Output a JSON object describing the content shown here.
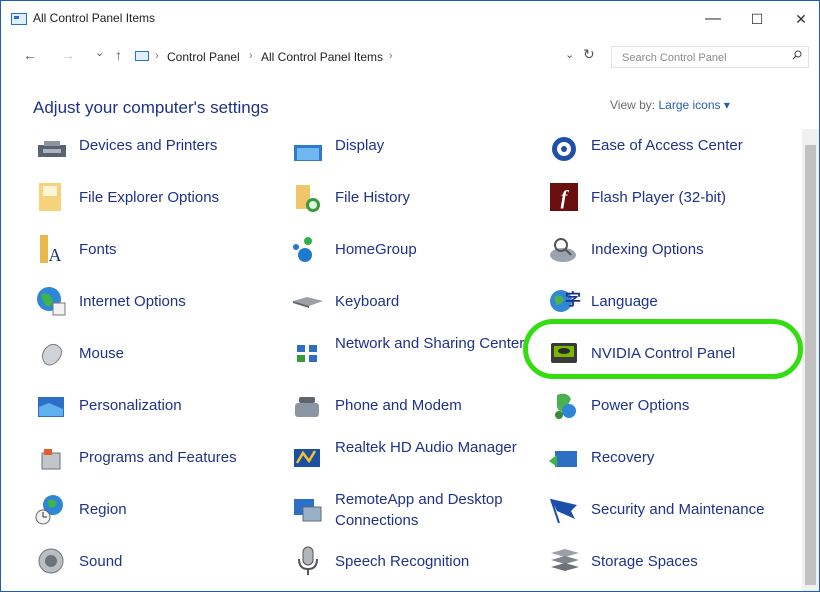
{
  "window": {
    "title": "All Control Panel Items",
    "minimize": "—",
    "maximize": "☐",
    "close": "✕"
  },
  "address": {
    "back": "←",
    "forward": "→",
    "recent": "⌄",
    "up": "↑",
    "crumbs": [
      "Control Panel",
      "All Control Panel Items"
    ],
    "separator": "›",
    "dropdown": "⌄",
    "refresh": "↻"
  },
  "search": {
    "placeholder": "Search Control Panel"
  },
  "page": {
    "heading": "Adjust your computer's settings"
  },
  "view": {
    "label": "View by:",
    "mode": "Large icons ▾"
  },
  "items": [
    [
      "Devices and Printers",
      "Display",
      "Ease of Access Center"
    ],
    [
      "File Explorer Options",
      "File History",
      "Flash Player (32-bit)"
    ],
    [
      "Fonts",
      "HomeGroup",
      "Indexing Options"
    ],
    [
      "Internet Options",
      "Keyboard",
      "Language"
    ],
    [
      "Mouse",
      "Network and Sharing Center",
      "NVIDIA Control Panel"
    ],
    [
      "Personalization",
      "Phone and Modem",
      "Power Options"
    ],
    [
      "Programs and Features",
      "Realtek HD Audio Manager",
      "Recovery"
    ],
    [
      "Region",
      "RemoteApp and Desktop Connections",
      "Security and Maintenance"
    ],
    [
      "Sound",
      "Speech Recognition",
      "Storage Spaces"
    ]
  ],
  "colors": {
    "link": "#1e3287",
    "highlight": "#33dd11",
    "window_border": "#1a5fb4"
  }
}
